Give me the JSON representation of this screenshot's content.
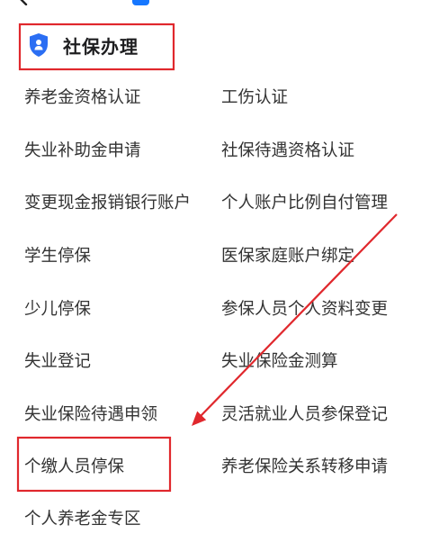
{
  "top_bar": {
    "back_icon": "chevron-left-icon",
    "app_icon": "mini-program-icon"
  },
  "section": {
    "title": "社保办理",
    "icon": "shield-person-icon",
    "highlighted": true
  },
  "services": {
    "items": [
      {
        "label": "养老金资格认证"
      },
      {
        "label": "工伤认证"
      },
      {
        "label": "失业补助金申请"
      },
      {
        "label": "社保待遇资格认证"
      },
      {
        "label": "变更现金报销银行账户"
      },
      {
        "label": "个人账户比例自付管理"
      },
      {
        "label": "学生停保"
      },
      {
        "label": "医保家庭账户绑定"
      },
      {
        "label": "少儿停保"
      },
      {
        "label": "参保人员个人资料变更"
      },
      {
        "label": "失业登记"
      },
      {
        "label": "失业保险金测算"
      },
      {
        "label": "失业保险待遇申领"
      },
      {
        "label": "灵活就业人员参保登记"
      },
      {
        "label": "个缴人员停保",
        "highlighted": true
      },
      {
        "label": "养老保险关系转移申请"
      },
      {
        "label": "个人养老金专区"
      }
    ]
  },
  "annotations": {
    "arrow_icon": "red-arrow-icon"
  },
  "colors": {
    "text": "#333333",
    "title": "#1d1d1f",
    "background": "#ffffff",
    "accent": "#2b6ef3",
    "annotation": "#e0282d",
    "app_icon": "#1677ff"
  }
}
